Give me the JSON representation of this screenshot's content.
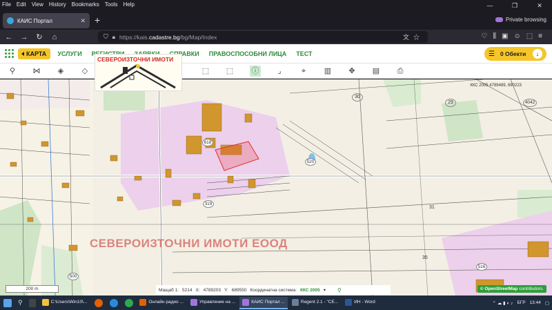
{
  "menubar": [
    "File",
    "Edit",
    "View",
    "History",
    "Bookmarks",
    "Tools",
    "Help"
  ],
  "window_controls": [
    "—",
    "❐",
    "✕"
  ],
  "tab": {
    "title": "КАИС Портал",
    "close": "✕"
  },
  "new_tab": "+",
  "private_label": "Private browsing",
  "url": {
    "prefix": "https://kais.",
    "domain": "cadastre.bg",
    "path": "/bg/Map/Index"
  },
  "app": {
    "menu": [
      "КАРТА",
      "УСЛУГИ",
      "РЕГИСТРИ",
      "ЗАЯВКИ",
      "СПРАВКИ",
      "ПРАВОСПОСОБНИ ЛИЦА",
      "ТЕСТ"
    ],
    "objects_label": "0 Обекти"
  },
  "logo": {
    "title": "СЕВЕРОИЗТОЧНИ ИМОТИ"
  },
  "map": {
    "watermark": "СЕВЕРОИЗТОЧНИ ИМОТИ ЕООД",
    "top_coords": "ККС 2005 4789489, 690223",
    "parcel_labels": [
      "30",
      "29",
      "4042",
      "618",
      "520",
      "319",
      "31",
      "35",
      "500",
      "516"
    ],
    "scale": "200 m",
    "osm": {
      "brand": "© OpenStreetMap",
      "suffix": "contributors."
    }
  },
  "status": {
    "scale_label": "Мащаб 1:",
    "scale_value": "5214",
    "x_label": "X:",
    "x_value": "4789203",
    "y_label": "Y:",
    "y_value": "689550",
    "cs_label": "Координатна система:",
    "cs_value": "ККС 2005"
  },
  "taskbar": {
    "apps": [
      "C:\\Users\\Win10\\...",
      "Онлайн радио ...",
      "Управление на ...",
      "КАИС Портал ...",
      "Regent 2.1 - \"СЕ...",
      "ИН - Word"
    ],
    "lang": "БГР",
    "time": "13:44"
  },
  "colors": {
    "accent_green": "#2e8b3a",
    "accent_yellow": "#f5c52a",
    "parcel_purple": "#e8c8e8",
    "building_brown": "#d1962e"
  }
}
